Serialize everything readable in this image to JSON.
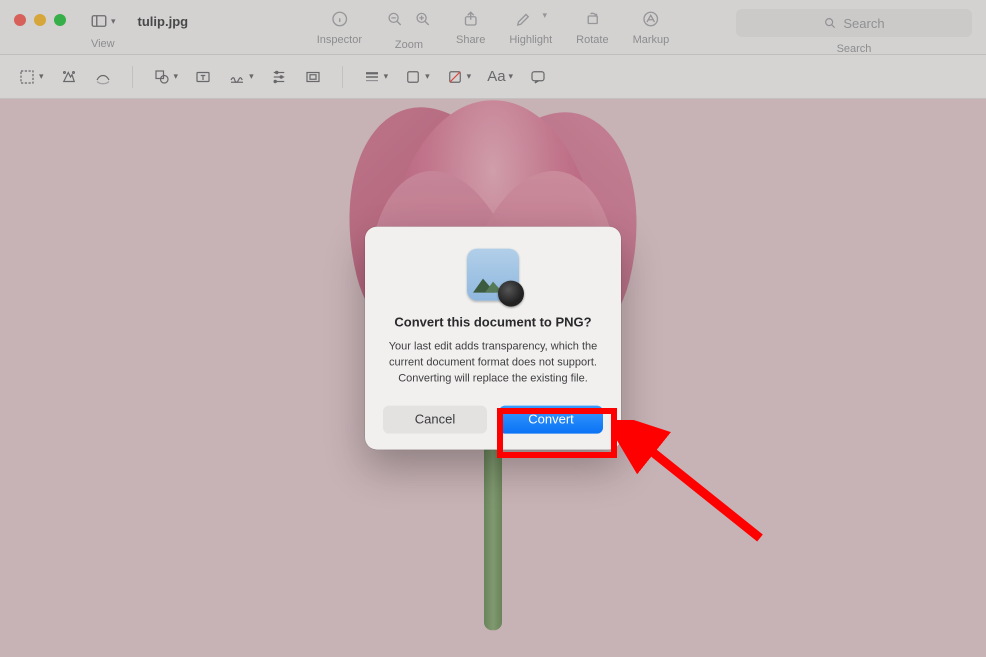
{
  "window": {
    "filename": "tulip.jpg"
  },
  "toolbar": {
    "view": "View",
    "inspector": "Inspector",
    "zoom": "Zoom",
    "share": "Share",
    "highlight": "Highlight",
    "rotate": "Rotate",
    "markup": "Markup",
    "search": "Search",
    "search_placeholder": "Search"
  },
  "modal": {
    "title": "Convert this document to PNG?",
    "message": "Your last edit adds transparency, which the current document format does not support. Converting will replace the existing file.",
    "cancel": "Cancel",
    "confirm": "Convert"
  }
}
